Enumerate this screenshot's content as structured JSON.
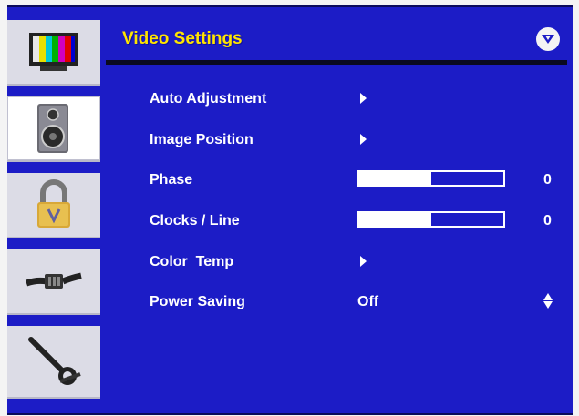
{
  "header": {
    "title": "Video Settings",
    "logo_icon": "v-chevron-logo-icon"
  },
  "sidebar": {
    "items": [
      {
        "name": "picture",
        "icon": "tv-test-pattern-icon",
        "active": false
      },
      {
        "name": "audio",
        "icon": "speaker-icon",
        "active": true
      },
      {
        "name": "parental-lock",
        "icon": "padlock-icon",
        "active": false
      },
      {
        "name": "connection",
        "icon": "cable-connector-icon",
        "active": false
      },
      {
        "name": "setup",
        "icon": "wrench-icon",
        "active": false
      }
    ]
  },
  "menu": {
    "items": [
      {
        "label": "Auto Adjustment",
        "control": "submenu"
      },
      {
        "label": "Image Position",
        "control": "submenu"
      },
      {
        "label": "Phase",
        "control": "slider",
        "value": "0",
        "fill_fraction": 0.5
      },
      {
        "label": "Clocks / Line",
        "control": "slider",
        "value": "0",
        "fill_fraction": 0.5
      },
      {
        "label": "Color  Temp",
        "control": "submenu"
      },
      {
        "label": "Power Saving",
        "control": "option",
        "value": "Off"
      }
    ]
  },
  "colors": {
    "background": "#1c1cc6",
    "title": "#ffe400",
    "text": "#ffffff",
    "sidebar": "#dcdce6"
  }
}
